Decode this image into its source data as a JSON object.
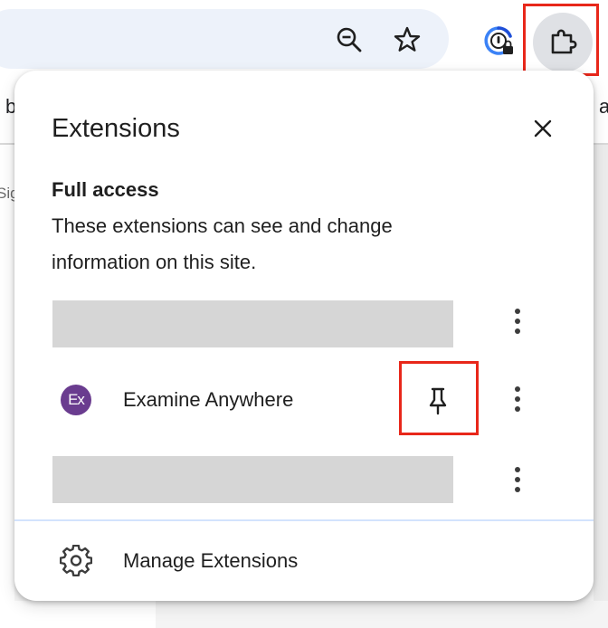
{
  "toolbar": {
    "icons": {
      "zoom": "zoom-out-icon",
      "bookmark": "star-icon",
      "password_manager": "password-manager-icon",
      "extensions": "puzzle-icon"
    }
  },
  "background": {
    "bookmark_bar_left": "b",
    "bookmark_bar_right": "a",
    "page_left_text": "Sig"
  },
  "popup": {
    "title": "Extensions",
    "close_icon": "close-icon",
    "section": {
      "heading": "Full access",
      "description": "These extensions can see and change information on this site."
    },
    "extensions": [
      {
        "redacted": true
      },
      {
        "name": "Examine Anywhere",
        "logo_text": "Ex",
        "logo_color": "#6a3c8f",
        "pin_icon": "pin-icon"
      },
      {
        "redacted": true
      }
    ],
    "more_icon": "more-vert-icon",
    "manage": {
      "label": "Manage Extensions",
      "icon": "gear-icon"
    }
  },
  "colors": {
    "highlight": "#e8271a",
    "omnibox": "#edf2fa",
    "redaction": "#d6d6d6",
    "divider": "#d3e3fd"
  }
}
